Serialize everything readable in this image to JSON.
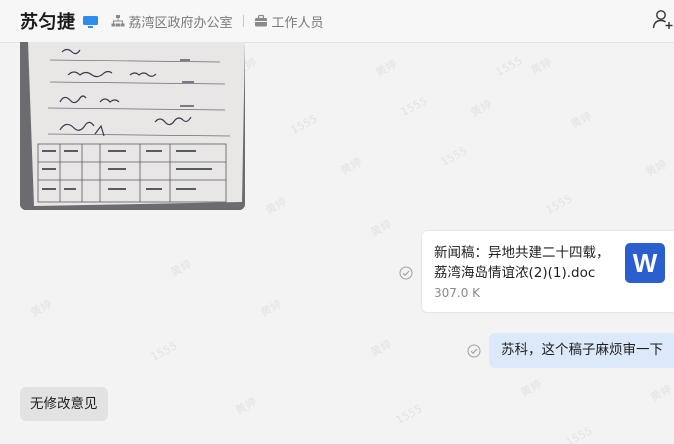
{
  "header": {
    "contact_name": "苏匀捷",
    "department": "荔湾区政府办公室",
    "role": "工作人员",
    "status_icon": "desktop-online-icon",
    "department_icon": "org-chart-icon",
    "role_icon": "briefcase-icon",
    "add_member_icon": "add-user-icon"
  },
  "messages": [
    {
      "type": "image",
      "side": "left",
      "description_icon": "photo-document-image"
    },
    {
      "type": "file",
      "side": "right",
      "file_name": "新闻稿：异地共建二十四载，荔湾海岛情谊浓(2)(1).doc",
      "file_size": "307.0 K",
      "file_icon_letter": "W",
      "file_icon_color": "#2b5fcf"
    },
    {
      "type": "text",
      "side": "right",
      "text": "苏科，这个稿子麻烦审一下"
    },
    {
      "type": "text",
      "side": "left",
      "text": "无修改意见"
    }
  ],
  "watermark": {
    "lines": [
      "黄婷",
      "1555"
    ]
  },
  "colors": {
    "background": "#f3f3f3",
    "bubble_self": "#dce9fb",
    "bubble_other": "#e2e2e2",
    "accent": "#2b5fcf"
  }
}
